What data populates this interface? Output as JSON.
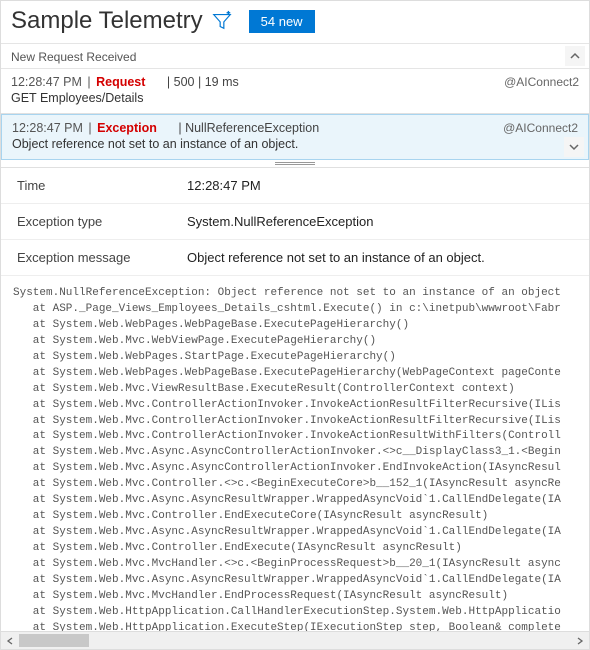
{
  "header": {
    "title": "Sample Telemetry",
    "badge_label": "54 new"
  },
  "section_label": "New Request Received",
  "entries": [
    {
      "time": "12:28:47 PM",
      "kind": "Request",
      "meta": "| 500 | 19 ms",
      "line2": "GET Employees/Details",
      "source": "@AIConnect2"
    },
    {
      "time": "12:28:47 PM",
      "kind": "Exception",
      "meta": "| NullReferenceException",
      "line2": "Object reference not set to an instance of an object.",
      "source": "@AIConnect2"
    }
  ],
  "details": {
    "time_label": "Time",
    "time_value": "12:28:47 PM",
    "type_label": "Exception type",
    "type_value": "System.NullReferenceException",
    "msg_label": "Exception message",
    "msg_value": "Object reference not set to an instance of an object."
  },
  "stack_trace": "System.NullReferenceException: Object reference not set to an instance of an object\n   at ASP._Page_Views_Employees_Details_cshtml.Execute() in c:\\inetpub\\wwwroot\\Fabr\n   at System.Web.WebPages.WebPageBase.ExecutePageHierarchy()\n   at System.Web.Mvc.WebViewPage.ExecutePageHierarchy()\n   at System.Web.WebPages.StartPage.ExecutePageHierarchy()\n   at System.Web.WebPages.WebPageBase.ExecutePageHierarchy(WebPageContext pageConte\n   at System.Web.Mvc.ViewResultBase.ExecuteResult(ControllerContext context)\n   at System.Web.Mvc.ControllerActionInvoker.InvokeActionResultFilterRecursive(ILis\n   at System.Web.Mvc.ControllerActionInvoker.InvokeActionResultFilterRecursive(ILis\n   at System.Web.Mvc.ControllerActionInvoker.InvokeActionResultWithFilters(Controll\n   at System.Web.Mvc.Async.AsyncControllerActionInvoker.<>c__DisplayClass3_1.<Begin\n   at System.Web.Mvc.Async.AsyncControllerActionInvoker.EndInvokeAction(IAsyncResul\n   at System.Web.Mvc.Controller.<>c.<BeginExecuteCore>b__152_1(IAsyncResult asyncRe\n   at System.Web.Mvc.Async.AsyncResultWrapper.WrappedAsyncVoid`1.CallEndDelegate(IA\n   at System.Web.Mvc.Controller.EndExecuteCore(IAsyncResult asyncResult)\n   at System.Web.Mvc.Async.AsyncResultWrapper.WrappedAsyncVoid`1.CallEndDelegate(IA\n   at System.Web.Mvc.Controller.EndExecute(IAsyncResult asyncResult)\n   at System.Web.Mvc.MvcHandler.<>c.<BeginProcessRequest>b__20_1(IAsyncResult async\n   at System.Web.Mvc.Async.AsyncResultWrapper.WrappedAsyncVoid`1.CallEndDelegate(IA\n   at System.Web.Mvc.MvcHandler.EndProcessRequest(IAsyncResult asyncResult)\n   at System.Web.HttpApplication.CallHandlerExecutionStep.System.Web.HttpApplicatio\n   at System.Web.HttpApplication.ExecuteStep(IExecutionStep step, Boolean& complete"
}
